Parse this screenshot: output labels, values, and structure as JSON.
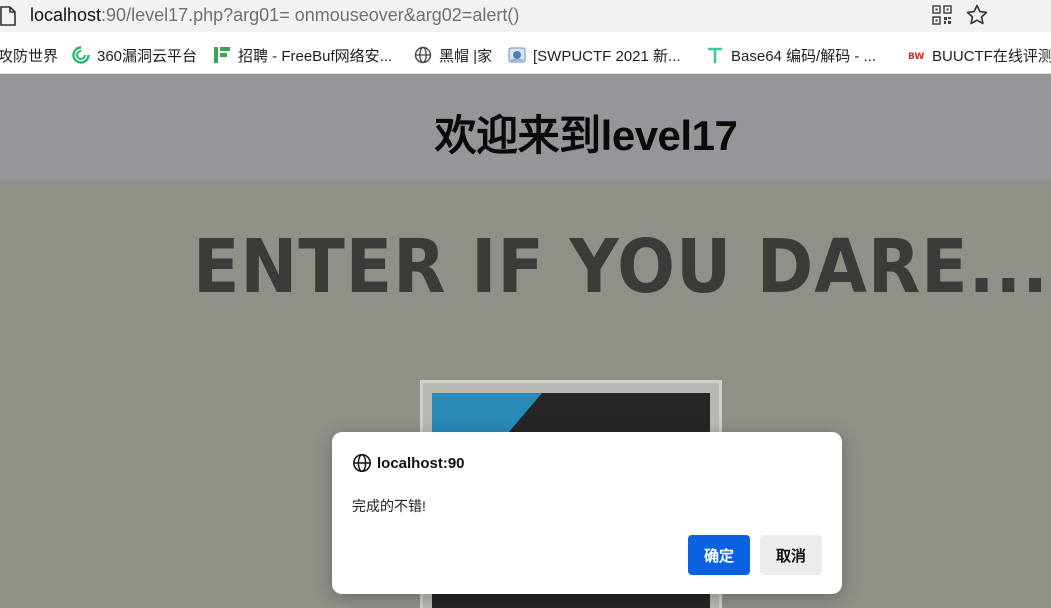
{
  "browser": {
    "url_host": "localhost",
    "url_rest": ":90/level17.php?arg01= onmouseover&arg02=alert()"
  },
  "bookmarks": [
    {
      "label": "攻防世界",
      "icon": "none"
    },
    {
      "label": "360漏洞云平台",
      "icon": "360-logo-icon",
      "color": "#2bb673"
    },
    {
      "label": "招聘 - FreeBuf网络安...",
      "icon": "freebuf-logo-icon",
      "color": "#3aa655"
    },
    {
      "label": "黑帽 |家",
      "icon": "globe-icon"
    },
    {
      "label": "[SWPUCTF 2021 新...",
      "icon": "nssctf-logo-icon"
    },
    {
      "label": "Base64 编码/解码 - ...",
      "icon": "t-logo-icon",
      "color": "#3cc8a0"
    },
    {
      "label": "BUUCTF在线评测",
      "icon": "buu-logo-icon",
      "color": "#c0392b"
    }
  ],
  "page": {
    "title": "欢迎来到level17",
    "banner_text": "ENTER IF YOU DARE..."
  },
  "dialog": {
    "origin": "localhost:90",
    "message": "完成的不错!",
    "ok_label": "确定",
    "cancel_label": "取消",
    "accent": "#0a62e0"
  }
}
